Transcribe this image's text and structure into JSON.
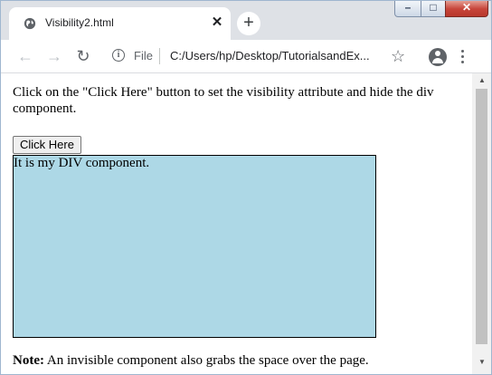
{
  "tab": {
    "title": "Visibility2.html",
    "favicon": "globe-icon",
    "close_glyph": "✕"
  },
  "newtab_glyph": "+",
  "window_controls": {
    "minimize": "–",
    "maximize": "□",
    "close": "✕"
  },
  "toolbar": {
    "back": "←",
    "forward": "→",
    "reload": "↻",
    "info": "i",
    "scheme_label": "File",
    "url": "C:/Users/hp/Desktop/TutorialsandEx...",
    "star": "☆"
  },
  "page": {
    "instruction": "Click on the \"Click Here\" button to set the visibility attribute and hide the div component.",
    "button_label": "Click Here",
    "div_text": "It is my DIV component.",
    "note_label": "Note:",
    "note_text": " An invisible component also grabs the space over the page."
  },
  "scrollbar": {
    "up": "▲",
    "down": "▼"
  },
  "colors": {
    "div_background": "#add8e6",
    "tab_strip": "#dee1e6"
  }
}
